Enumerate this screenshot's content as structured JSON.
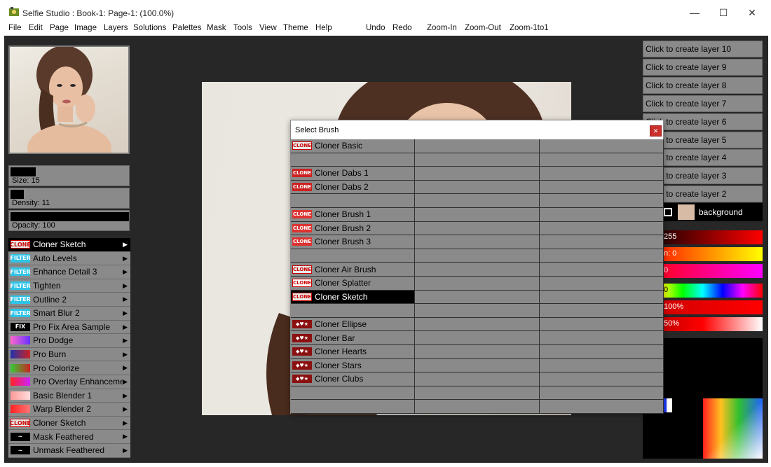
{
  "window": {
    "title": "Selfie Studio : Book-1: Page-1:  (100.0%)",
    "minimize_glyph": "—",
    "maximize_glyph": "☐",
    "close_glyph": "✕"
  },
  "menu": {
    "items": [
      "File",
      "Edit",
      "Page",
      "Image",
      "Layers",
      "Solutions",
      "Palettes",
      "Mask",
      "Tools",
      "View",
      "Theme",
      "Help"
    ],
    "actions": [
      "Undo",
      "Redo",
      "Zoom-In",
      "Zoom-Out",
      "Zoom-1to1"
    ]
  },
  "left_panel": {
    "size_label": "Size: 15",
    "density_label": "Density: 11",
    "opacity_label": "Opacity: 100",
    "size_value": 15,
    "density_value": 11,
    "opacity_value": 100,
    "brushes": [
      {
        "icon": "CLONE",
        "label": "Cloner Sketch",
        "active": true
      },
      {
        "icon": "FILTER",
        "label": "Auto Levels"
      },
      {
        "icon": "FILTER",
        "label": "Enhance Detail 3"
      },
      {
        "icon": "FILTER",
        "label": "Tighten"
      },
      {
        "icon": "FILTER",
        "label": "Outline 2"
      },
      {
        "icon": "FILTER",
        "label": "Smart Blur 2"
      },
      {
        "icon": "FIX",
        "label": "Pro Fix Area Sample"
      },
      {
        "icon": "dodge",
        "label": "Pro Dodge"
      },
      {
        "icon": "burn",
        "label": "Pro Burn"
      },
      {
        "icon": "colorize",
        "label": "Pro Colorize"
      },
      {
        "icon": "overlay",
        "label": "Pro Overlay Enhancement"
      },
      {
        "icon": "blender",
        "label": "Basic Blender 1"
      },
      {
        "icon": "warp",
        "label": "Warp Blender 2"
      },
      {
        "icon": "CLONE",
        "label": "Cloner Sketch"
      },
      {
        "icon": "mask",
        "label": "Mask Feathered"
      },
      {
        "icon": "mask",
        "label": "Unmask Feathered"
      }
    ]
  },
  "right_panel": {
    "layers": [
      "Click to create layer 10",
      "Click to create layer 9",
      "Click to create layer 8",
      "Click to create layer 7",
      "Click to create layer 6",
      "Click to create layer 5",
      "Click to create layer 4",
      "Click to create layer 3",
      "Click to create layer 2"
    ],
    "background_layer": "background",
    "color_sliders": [
      {
        "label": "255",
        "gradient": "red"
      },
      {
        "label": "n: 0",
        "gradient": "orange"
      },
      {
        "label": "0",
        "gradient": "magenta"
      },
      {
        "label": "0",
        "gradient": "hue"
      },
      {
        "label": "100%",
        "gradient": "red-solid"
      },
      {
        "label": "50%",
        "gradient": "red-white"
      }
    ]
  },
  "dialog": {
    "title": "Select Brush",
    "close_glyph": "✕",
    "items": [
      {
        "row": 0,
        "icon": "CLONE",
        "label": "Cloner Basic"
      },
      {
        "row": 2,
        "icon": "dabs",
        "label": "Cloner Dabs 1"
      },
      {
        "row": 3,
        "icon": "dabs",
        "label": "Cloner Dabs 2"
      },
      {
        "row": 5,
        "icon": "brush",
        "label": "Cloner Brush 1"
      },
      {
        "row": 6,
        "icon": "brush",
        "label": "Cloner Brush 2"
      },
      {
        "row": 7,
        "icon": "brush",
        "label": "Cloner Brush 3"
      },
      {
        "row": 9,
        "icon": "CLONE",
        "label": "Cloner Air Brush"
      },
      {
        "row": 10,
        "icon": "splatter",
        "label": "Cloner Splatter"
      },
      {
        "row": 11,
        "icon": "CLONE",
        "label": "Cloner Sketch",
        "active": true
      },
      {
        "row": 13,
        "icon": "shape",
        "label": "Cloner Ellipse"
      },
      {
        "row": 14,
        "icon": "shape",
        "label": "Cloner Bar"
      },
      {
        "row": 15,
        "icon": "shape",
        "label": "Cloner Hearts"
      },
      {
        "row": 16,
        "icon": "shape",
        "label": "Cloner Stars"
      },
      {
        "row": 17,
        "icon": "shape",
        "label": "Cloner Clubs"
      }
    ],
    "row_count": 20
  }
}
